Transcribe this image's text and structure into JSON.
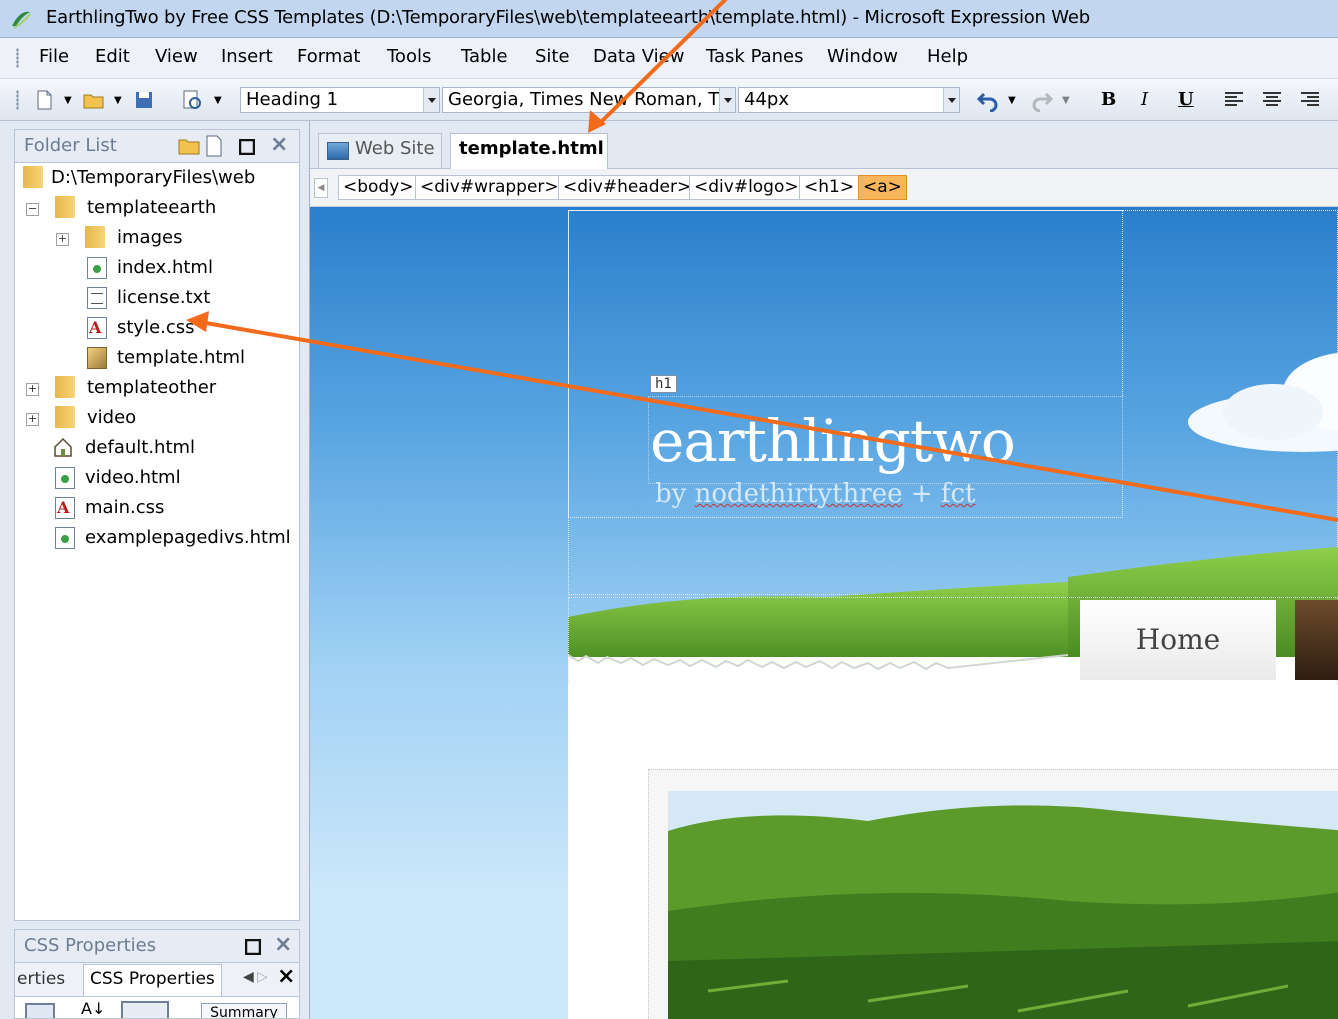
{
  "window": {
    "title": "EarthlingTwo by Free CSS Templates (D:\\TemporaryFiles\\web\\templateearth\\template.html) - Microsoft Expression Web"
  },
  "menu": {
    "items": [
      {
        "label": "File"
      },
      {
        "label": "Edit"
      },
      {
        "label": "View"
      },
      {
        "label": "Insert"
      },
      {
        "label": "Format"
      },
      {
        "label": "Tools"
      },
      {
        "label": "Table"
      },
      {
        "label": "Site"
      },
      {
        "label": "Data View"
      },
      {
        "label": "Task Panes"
      },
      {
        "label": "Window"
      },
      {
        "label": "Help"
      }
    ]
  },
  "toolbar": {
    "style_value": "Heading 1",
    "font_value": "Georgia, Times New Roman, T",
    "size_value": "44px",
    "bold_label": "B",
    "italic_label": "I",
    "underline_label": "U"
  },
  "folder_panel": {
    "title": "Folder List",
    "root": "D:\\TemporaryFiles\\web",
    "nodes": [
      {
        "label": "templateearth",
        "icon": "folder-icon"
      },
      {
        "label": "images",
        "icon": "folder-icon"
      },
      {
        "label": "index.html",
        "icon": "html-file-icon"
      },
      {
        "label": "license.txt",
        "icon": "text-file-icon"
      },
      {
        "label": "style.css",
        "icon": "css-file-icon"
      },
      {
        "label": "template.html",
        "icon": "template-file-icon"
      },
      {
        "label": "templateother",
        "icon": "folder-icon"
      },
      {
        "label": "video",
        "icon": "folder-icon"
      },
      {
        "label": "default.html",
        "icon": "home-page-icon"
      },
      {
        "label": "video.html",
        "icon": "html-file-icon"
      },
      {
        "label": "main.css",
        "icon": "css-file-icon"
      },
      {
        "label": "examplepagedivs.html",
        "icon": "html-file-icon"
      }
    ]
  },
  "css_panel": {
    "title": "CSS Properties",
    "tab_prev": "erties",
    "tab_active": "CSS Properties",
    "summary_label": "Summary"
  },
  "doc_tabs": [
    {
      "label": "Web Site"
    },
    {
      "label": "template.html"
    }
  ],
  "breadcrumbs": [
    "<body>",
    "<div#wrapper>",
    "<div#header>",
    "<div#logo>",
    "<h1>",
    "<a>"
  ],
  "page": {
    "h1_tag": "h1",
    "logo_title": "earthlingtwo",
    "tagline_pre": "by ",
    "tagline_word1": "nodethirtythree",
    "tagline_mid": " + ",
    "tagline_word2": "fct",
    "nav_home": "Home"
  },
  "colors": {
    "annotation_arrow": "#f26a1b",
    "sky_top": "#2a7fcb",
    "grass": "#5fa82a",
    "breadcrumb_selected": "#f9b55a"
  }
}
